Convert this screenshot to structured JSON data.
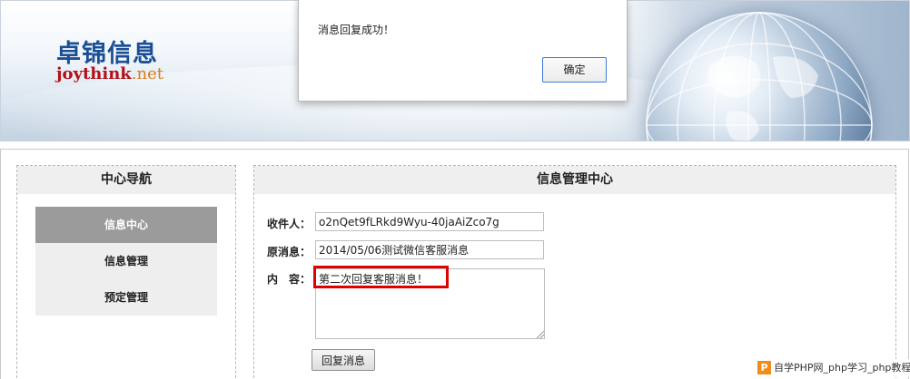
{
  "header": {
    "logo_cn": "卓锦信息",
    "logo_en_main": "joythink",
    "logo_en_suffix": ".net"
  },
  "alert": {
    "message": "消息回复成功！",
    "ok_label": "确定"
  },
  "nav": {
    "title": "中心导航",
    "items": [
      {
        "label": "信息中心",
        "active": true
      },
      {
        "label": "信息管理",
        "active": false
      },
      {
        "label": "预定管理",
        "active": false
      }
    ]
  },
  "content": {
    "title": "信息管理中心",
    "recipient_label": "收件人：",
    "recipient_value": "o2nQet9fLRkd9Wyu-40jaAiZco7g",
    "original_label": "原消息：",
    "original_value": "2014/05/06测试微信客服消息",
    "content_label": "内　容：",
    "content_value": "第二次回复客服消息！",
    "submit_label": "回复消息"
  },
  "watermark": {
    "icon": "P",
    "text": "自学PHP网_php学习_php教程"
  },
  "colors": {
    "logo_cn": "#1b4f95",
    "logo_en": "#b30f17",
    "logo_net": "#d97b18",
    "nav_active_bg": "#9b9b9b",
    "highlight": "#e00000",
    "dialog_button_border": "#3d7bd4"
  }
}
